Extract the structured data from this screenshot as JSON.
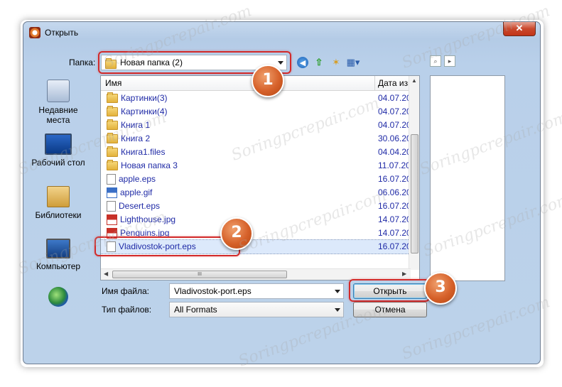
{
  "window": {
    "title": "Открыть",
    "close_label": "✕"
  },
  "toolbar": {
    "folder_label": "Папка:",
    "folder_value": "Новая папка (2)",
    "icons": [
      "back-icon",
      "up-folder-icon",
      "new-folder-icon",
      "view-menu-icon"
    ]
  },
  "places": [
    {
      "label": "Недавние места"
    },
    {
      "label": "Рабочий стол"
    },
    {
      "label": "Библиотеки"
    },
    {
      "label": "Компьютер"
    },
    {
      "label": ""
    }
  ],
  "filelist": {
    "col_name": "Имя",
    "col_date": "Дата изм",
    "rows": [
      {
        "name": "Картинки(3)",
        "date": "04.07.20",
        "type": "folder"
      },
      {
        "name": "Картинки(4)",
        "date": "04.07.20",
        "type": "folder"
      },
      {
        "name": "Книга 1",
        "date": "04.07.20",
        "type": "folder"
      },
      {
        "name": "Книга 2",
        "date": "30.06.20",
        "type": "folder"
      },
      {
        "name": "Книга1.files",
        "date": "04.04.20",
        "type": "folder"
      },
      {
        "name": "Новая папка 3",
        "date": "11.07.20",
        "type": "folder"
      },
      {
        "name": "apple.eps",
        "date": "16.07.20",
        "type": "file"
      },
      {
        "name": "apple.gif",
        "date": "06.06.20",
        "type": "gif"
      },
      {
        "name": "Desert.eps",
        "date": "16.07.20",
        "type": "file"
      },
      {
        "name": "Lighthouse.jpg",
        "date": "14.07.20",
        "type": "jpg"
      },
      {
        "name": "Penguins.jpg",
        "date": "14.07.20",
        "type": "jpg"
      },
      {
        "name": "Vladivostok-port.eps",
        "date": "16.07.20",
        "type": "file",
        "selected": true
      }
    ],
    "hscroll_thumb_label": "III"
  },
  "form": {
    "filename_label": "Имя файла:",
    "filename_value": "Vladivostok-port.eps",
    "filetype_label": "Тип файлов:",
    "filetype_value": "All Formats",
    "open_button": "Открыть",
    "cancel_button": "Отмена"
  },
  "callouts": [
    "1",
    "2",
    "3"
  ],
  "watermark": "Soringpcrepair.com",
  "colors": {
    "callout_red": "#d22a2a",
    "badge_orange": "#d6612a",
    "link_blue": "#1f2aa6",
    "selection": "#dce9fb"
  }
}
